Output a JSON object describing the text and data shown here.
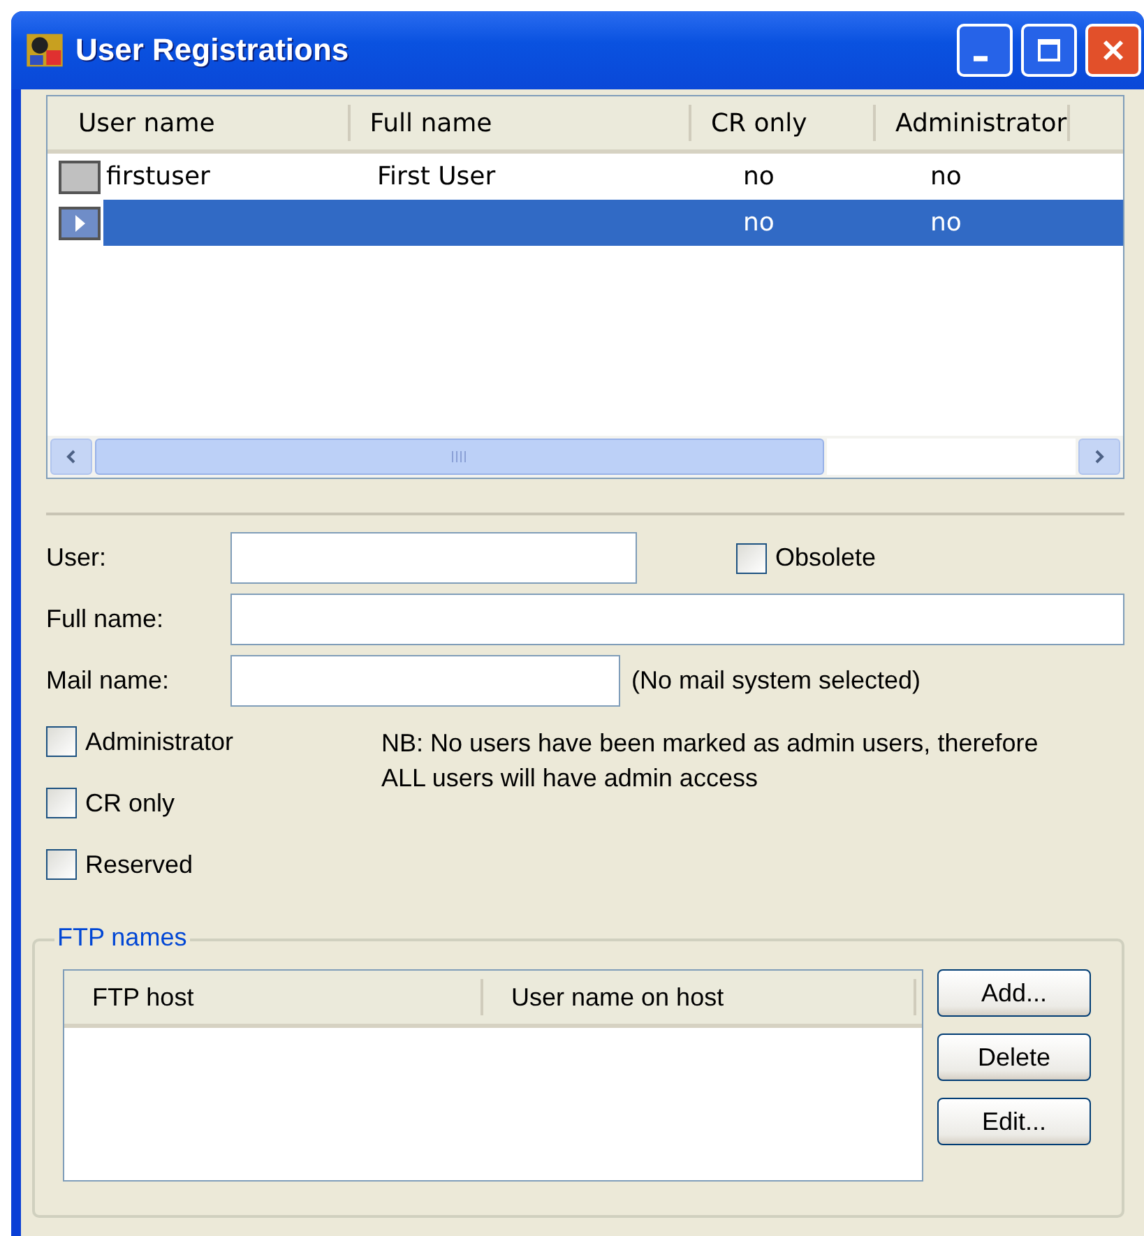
{
  "window": {
    "title": "User Registrations"
  },
  "users_table": {
    "columns": [
      "User name",
      "Full name",
      "CR only",
      "Administrator"
    ],
    "rows": [
      {
        "selected": false,
        "cells": [
          "firstuser",
          "First User",
          "no",
          "no"
        ]
      },
      {
        "selected": true,
        "cells": [
          "",
          "",
          "no",
          "no"
        ]
      }
    ]
  },
  "form": {
    "user_label": "User:",
    "obsolete": {
      "label": "Obsolete",
      "checked": false
    },
    "full_name_label": "Full name:",
    "mail_name_label": "Mail name:",
    "mail_note": "(No mail system selected)",
    "options": [
      {
        "label": "Administrator",
        "checked": false
      },
      {
        "label": "CR only",
        "checked": false
      },
      {
        "label": "Reserved",
        "checked": false
      }
    ],
    "admin_note": "NB: No users have been marked as admin users, therefore ALL users will have admin access"
  },
  "ftp_names": {
    "title": "FTP names",
    "columns": [
      "FTP host",
      "User name on host"
    ],
    "buttons": [
      "Add...",
      "Delete",
      "Edit..."
    ]
  }
}
